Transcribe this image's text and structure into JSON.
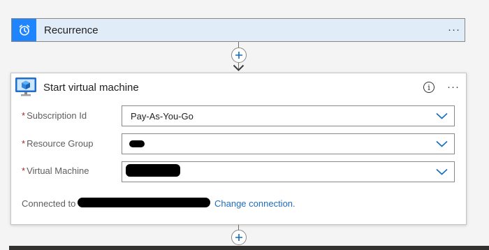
{
  "trigger": {
    "title": "Recurrence",
    "icon": "alarm-clock-icon",
    "more_label": "···",
    "accent": "#1f85ff"
  },
  "connector": {
    "add_label": "+"
  },
  "action": {
    "title": "Start virtual machine",
    "icon": "virtual-machine-icon",
    "more_label": "···",
    "info_label": "i",
    "fields": [
      {
        "label": "Subscription Id",
        "value": "Pay-As-You-Go",
        "required": true
      },
      {
        "label": "Resource Group",
        "value": "",
        "required": true
      },
      {
        "label": "Virtual Machine",
        "value": "",
        "required": true
      }
    ],
    "connected_label": "Connected to",
    "change_connection": "Change connection."
  },
  "colors": {
    "chevron": "#0f6cbd",
    "link": "#1f6dbf",
    "required": "#a4262c"
  }
}
